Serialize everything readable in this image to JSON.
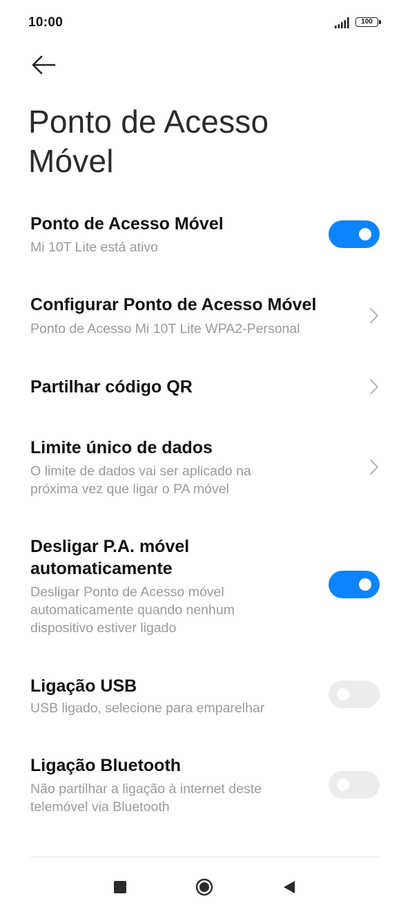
{
  "status_bar": {
    "time": "10:00",
    "battery_level": "100",
    "signal_icon": "signal-bars-icon",
    "battery_icon": "battery-icon"
  },
  "header": {
    "back_icon": "arrow-left-icon",
    "title": "Ponto de Acesso Móvel"
  },
  "settings": {
    "hotspot": {
      "title": "Ponto de Acesso Móvel",
      "subtitle": "Mi 10T Lite está ativo",
      "enabled": true
    },
    "configure": {
      "title": "Configurar Ponto de Acesso Móvel",
      "subtitle": "Ponto de Acesso Mi 10T Lite WPA2-Personal"
    },
    "share_qr": {
      "title": "Partilhar código QR"
    },
    "data_limit": {
      "title": "Limite único de dados",
      "subtitle_line1": "O limite de dados vai ser aplicado na",
      "subtitle_line2": "próxima vez que ligar o PA móvel"
    },
    "auto_off": {
      "title_line1": "Desligar P.A. móvel",
      "title_line2": "automaticamente",
      "subtitle_line1": "Desligar Ponto de Acesso móvel",
      "subtitle_line2": "automaticamente quando nenhum",
      "subtitle_line3": "dispositivo estiver ligado",
      "enabled": true
    },
    "usb": {
      "title": "Ligação USB",
      "subtitle": "USB ligado, selecione para emparelhar",
      "enabled": false
    },
    "bluetooth": {
      "title": "Ligação Bluetooth",
      "subtitle_line1": "Não partilhar a ligação à internet deste",
      "subtitle_line2": "telemóvel via Bluetooth",
      "enabled": false
    }
  },
  "nav_bar": {
    "recent_icon": "square-recent-apps-icon",
    "home_icon": "circle-home-icon",
    "back_icon": "triangle-back-icon"
  },
  "colors": {
    "accent": "#0d84ff",
    "toggle_off": "#ececec",
    "subtitle": "#9a9a9a",
    "title": "#111111"
  }
}
